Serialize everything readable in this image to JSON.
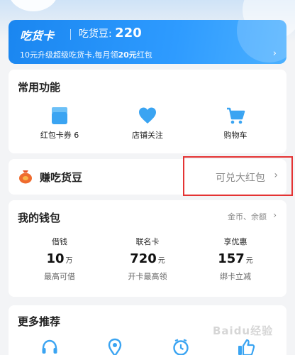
{
  "member_card": {
    "title": "吃货卡",
    "beans_label": "吃货豆: ",
    "beans_value": "220",
    "sub_prefix": "10元升级超级吃货卡,每月领",
    "sub_amount": "20元",
    "sub_suffix": "红包",
    "arrow": "›"
  },
  "common_functions": {
    "title": "常用功能",
    "items": [
      {
        "label": "红包卡券 6",
        "icon": "coupon-icon"
      },
      {
        "label": "店铺关注",
        "icon": "heart-icon"
      },
      {
        "label": "购物车",
        "icon": "cart-icon"
      }
    ]
  },
  "earn_beans": {
    "title": "赚吃货豆",
    "action": "可兑大红包",
    "chevron": "›",
    "icon": "money-bag-icon",
    "highlight_color": "#e43333"
  },
  "wallet": {
    "title": "我的钱包",
    "action": "金币、余额",
    "chevron": "›",
    "stats": [
      {
        "title": "借钱",
        "value": "10",
        "unit": "万",
        "sub": "最高可借"
      },
      {
        "title": "联名卡",
        "value": "720",
        "unit": "元",
        "sub": "开卡最高领"
      },
      {
        "title": "享优惠",
        "value": "157",
        "unit": "元",
        "sub": "绑卡立减"
      }
    ]
  },
  "more": {
    "title": "更多推荐",
    "icons": [
      "headset-icon",
      "location-icon",
      "clock-icon",
      "thumbs-up-icon"
    ]
  },
  "watermark": "Baidu经验",
  "colors": {
    "accent": "#1a86f0",
    "icon_blue": "#3aa4f2"
  }
}
